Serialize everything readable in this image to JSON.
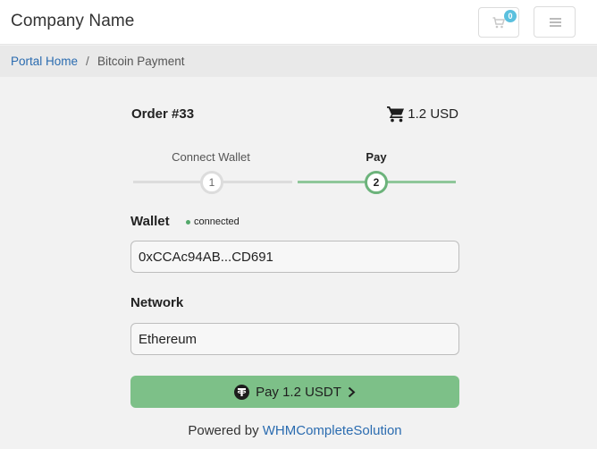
{
  "header": {
    "brand": "Company Name",
    "cart_count": "0"
  },
  "breadcrumb": {
    "home": "Portal Home",
    "separator": "/",
    "current": "Bitcoin Payment"
  },
  "order": {
    "title": "Order #33",
    "amount": "1.2 USD"
  },
  "steps": [
    {
      "label": "Connect Wallet",
      "number": "1",
      "state": "complete"
    },
    {
      "label": "Pay",
      "number": "2",
      "state": "active"
    }
  ],
  "wallet": {
    "label": "Wallet",
    "status": "connected",
    "address": "0xCCAc94AB...CD691"
  },
  "network": {
    "label": "Network",
    "value": "Ethereum"
  },
  "pay_button": {
    "label": "Pay 1.2 USDT"
  },
  "footer": {
    "powered_prefix": "Powered by",
    "powered_link": "WHMCompleteSolution"
  },
  "colors": {
    "accent_green": "#7dc088",
    "link_blue": "#2b6cb0",
    "badge_blue": "#5bc0de"
  },
  "icons": [
    "cart-icon",
    "menu-icon",
    "tether-icon",
    "chevron-right-icon"
  ]
}
